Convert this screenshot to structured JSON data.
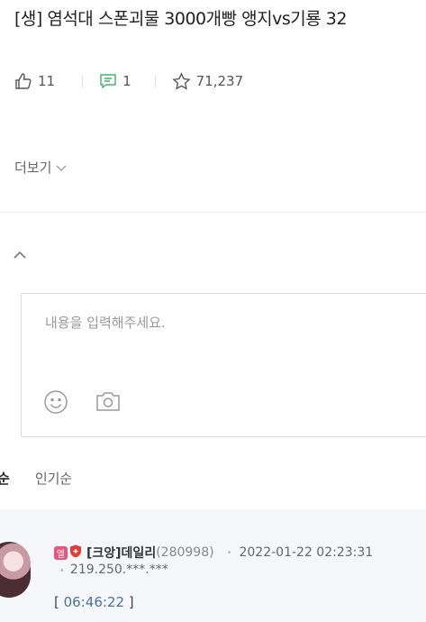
{
  "post": {
    "title": "[생] 염석대 스폰괴물 3000개빵 앵지vs기룡 32"
  },
  "stats": {
    "likes": "11",
    "comments": "1",
    "views": "71,237"
  },
  "more_label": "더보기",
  "comment_input": {
    "placeholder": "내용을 입력해주세요."
  },
  "sort_tabs": {
    "latest": "순",
    "popular": "인기순"
  },
  "comment": {
    "badge_text": "엘",
    "nickname": "[크앙]데일리",
    "count": "(280998)",
    "date": "2022-01-22 02:23:31",
    "ip": "219.250.***.***",
    "bracket_open": "[",
    "time_text": "06:46:22",
    "bracket_close": "]"
  },
  "colors": {
    "accent_link": "#4a6fa5",
    "badge_pink": "#e8547b",
    "comment_icon_green": "#3fb36b"
  }
}
